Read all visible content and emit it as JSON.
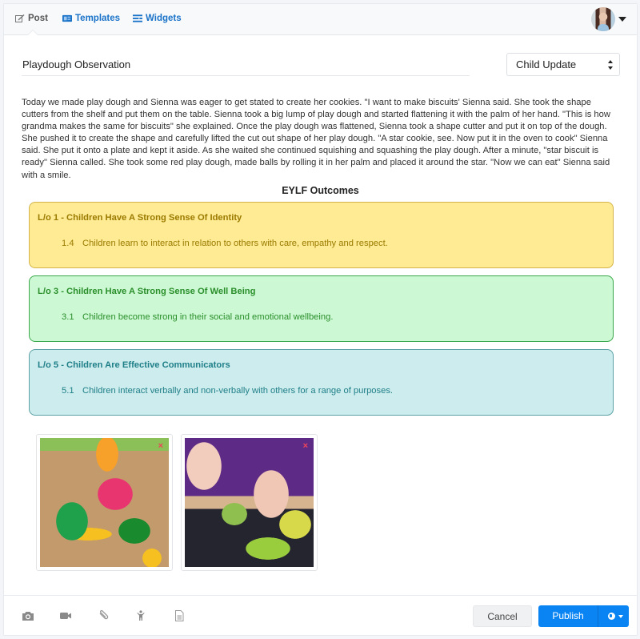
{
  "header": {
    "tabs": [
      {
        "label": "Post",
        "icon": "edit-icon",
        "active": true
      },
      {
        "label": "Templates",
        "icon": "templates-icon",
        "active": false
      },
      {
        "label": "Widgets",
        "icon": "widgets-icon",
        "active": false
      }
    ],
    "user_menu": {
      "icon": "avatar",
      "caret": "caret-down-icon"
    }
  },
  "post": {
    "title_value": "Playdough Observation",
    "type_select": {
      "selected": "Child Update"
    },
    "body": "Today we made play dough and Sienna was eager to get stated to create her cookies. \"I want to make biscuits' Sienna said. She took the shape cutters from the shelf and put them on the table.  Sienna took a big lump of play dough and started flattening it with the palm of her hand. \"This is how grandma makes the same for biscuits\" she explained. Once the play dough was flattened, Sienna took a shape cutter and put it on top of the dough. She pushed it to create the shape and carefully lifted the cut out shape of her play dough. \"A star cookie, see. Now put it in the oven to cook\" Sienna said. She put it onto a plate and kept it aside. As she waited she continued squishing and squashing the play dough. After a minute, \"star biscuit is ready\" Sienna called. She took some red play dough, made balls by rolling it in her palm and placed it around the star. \"Now we can eat\" Sienna said with a smile."
  },
  "outcomes": {
    "title": "EYLF Outcomes",
    "items": [
      {
        "heading": "L/o 1 - Children Have A Strong Sense Of Identity",
        "code": "1.4",
        "text": "Children learn to interact in relation to others with care, empathy and respect.",
        "color": "#feeb93"
      },
      {
        "heading": "L/o 3 - Children Have A Strong Sense Of Well Being",
        "code": "3.1",
        "text": "Children become strong in their social and emotional wellbeing.",
        "color": "#ccf8d4"
      },
      {
        "heading": "L/o 5 - Children Are Effective Communicators",
        "code": "5.1",
        "text": "Children interact verbally and non-verbally with others for a range of purposes.",
        "color": "#cdeced"
      }
    ]
  },
  "attachments": [
    {
      "description": "play dough and shape cutters on table",
      "remove_icon": "×"
    },
    {
      "description": "child cutting play dough with red tool",
      "remove_icon": "×"
    }
  ],
  "footer": {
    "tools": [
      "camera-icon",
      "video-icon",
      "paperclip-icon",
      "child-icon",
      "document-icon"
    ],
    "cancel_label": "Cancel",
    "publish_label": "Publish",
    "visibility_icon": "globe-icon",
    "accent_color": "#0a84f3"
  }
}
